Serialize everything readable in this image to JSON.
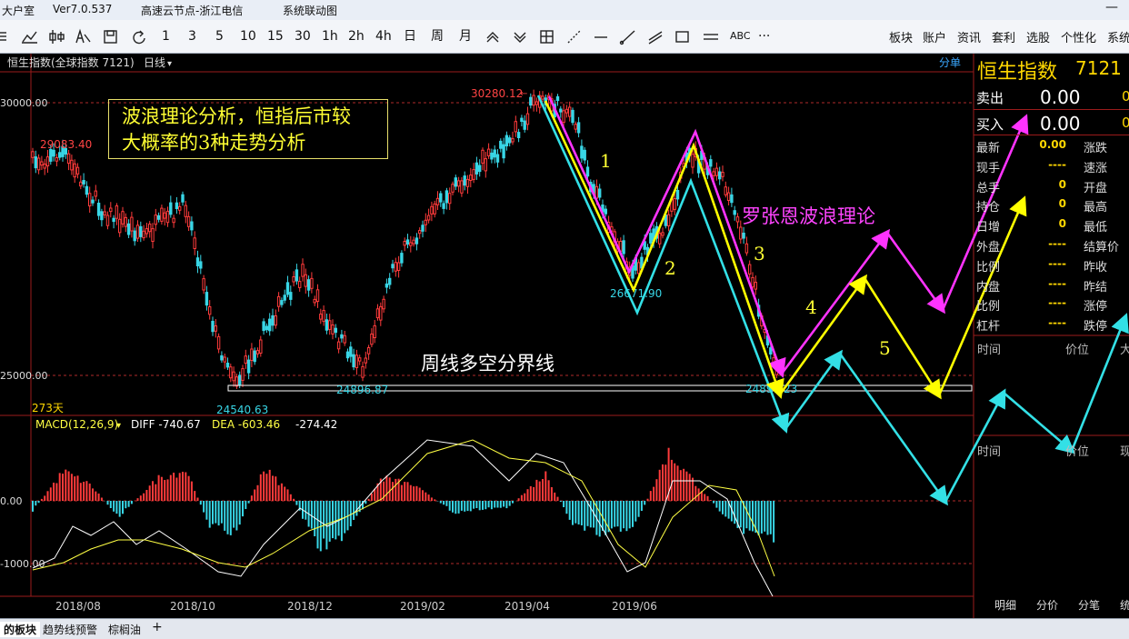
{
  "titlebar": {
    "app": "大户室",
    "version": "Ver7.0.537",
    "server": "高速云节点-浙江电信",
    "menu_title": "系统联动图"
  },
  "toolbar": {
    "items": [
      "1",
      "3",
      "5",
      "10",
      "15",
      "30",
      "1h",
      "2h",
      "4h",
      "日",
      "周",
      "月",
      "ABC",
      "···"
    ],
    "menu": [
      "板块",
      "账户",
      "资讯",
      "套利",
      "选股",
      "个性化",
      "系统"
    ]
  },
  "chart_header": {
    "symbol": "恒生指数(全球指数 7121)",
    "period": "日线",
    "right_label": "分单"
  },
  "price_axis": {
    "top": "30000.00",
    "bottom": "25000.00"
  },
  "price_labels": {
    "high": "30280.12",
    "left_high": "29083.40",
    "low1": "24540.63",
    "low2": "24896.87",
    "mid_low": "26671.90",
    "last_low": "24891.23",
    "days": "273天"
  },
  "annotations": {
    "box_line1": "波浪理论分析，恒指后市较",
    "box_line2": "大概率的3种走势分析",
    "wave_theory": "罗张恩波浪理论",
    "boundary": "周线多空分界线",
    "waves": [
      "1",
      "2",
      "3",
      "4",
      "5"
    ]
  },
  "macd": {
    "label": "MACD(12,26,9)",
    "diff_label": "DIFF",
    "diff": "-740.67",
    "dea_label": "DEA",
    "dea": "-603.46",
    "macd": "-274.42",
    "axis_zero": "0.00",
    "axis_neg": "-1000.00"
  },
  "dates": [
    "2018/08",
    "2018/10",
    "2018/12",
    "2019/02",
    "2019/04",
    "2019/06"
  ],
  "quote_panel": {
    "title": "恒生指数",
    "code": "7121",
    "sell_label": "卖出",
    "sell": "0.00",
    "buy_label": "买入",
    "buy": "0.00",
    "rows": [
      {
        "l1": "最新",
        "v1": "0.00",
        "l2": "涨跌",
        "v2": ""
      },
      {
        "l1": "现手",
        "v1": "----",
        "l2": "速涨",
        "v2": ""
      },
      {
        "l1": "总手",
        "v1": "0",
        "l2": "开盘",
        "v2": ""
      },
      {
        "l1": "持仓",
        "v1": "0",
        "l2": "最高",
        "v2": ""
      },
      {
        "l1": "日增",
        "v1": "0",
        "l2": "最低",
        "v2": ""
      },
      {
        "l1": "外盘",
        "v1": "----",
        "l2": "结算价",
        "v2": ""
      },
      {
        "l1": "比例",
        "v1": "----",
        "l2": "昨收",
        "v2": ""
      },
      {
        "l1": "内盘",
        "v1": "----",
        "l2": "昨结",
        "v2": ""
      },
      {
        "l1": "比例",
        "v1": "----",
        "l2": "涨停",
        "v2": ""
      },
      {
        "l1": "杠杆",
        "v1": "----",
        "l2": "跌停",
        "v2": ""
      }
    ],
    "tick_headers": [
      "时间",
      "价位",
      "大"
    ],
    "tick_headers2": [
      "时间",
      "价位",
      "现"
    ],
    "bottom_tabs": [
      "明细",
      "分价",
      "分笔",
      "统"
    ]
  },
  "statusbar": {
    "tabs": [
      "的板块",
      "趋势线预警",
      "棕榈油"
    ],
    "add": "+"
  },
  "colors": {
    "up": "#ff3b3b",
    "down": "#38d6e6",
    "yellow": "#ffff00",
    "magenta": "#ff33ff",
    "cyan": "#33e0e6",
    "label": "#ff4444"
  }
}
